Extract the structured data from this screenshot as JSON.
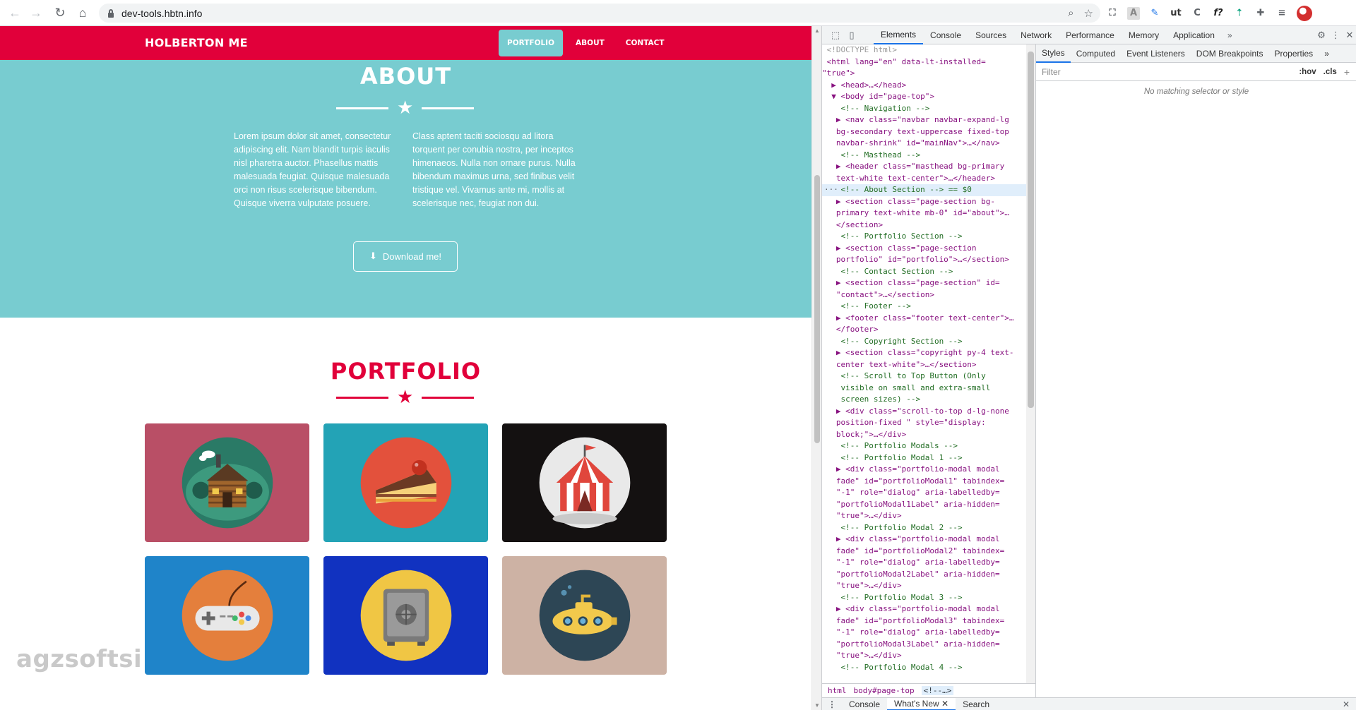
{
  "browser": {
    "url": "dev-tools.hbtn.info",
    "back_icon": "arrow-left-icon",
    "forward_icon": "arrow-right-icon",
    "reload_icon": "reload-icon",
    "home_icon": "home-icon",
    "extensions": [
      "zoom-icon",
      "bookmark-star-icon",
      "tab-search-icon",
      "extension-a-icon",
      "extension-feather-icon",
      "extension-ut-icon",
      "extension-c-icon",
      "extension-f-icon",
      "extension-arrow-icon",
      "puzzle-icon",
      "reading-list-icon",
      "profile-avatar"
    ]
  },
  "site": {
    "brand": "HOLBERTON ME",
    "nav": [
      {
        "label": "PORTFOLIO",
        "active": true
      },
      {
        "label": "ABOUT",
        "active": false
      },
      {
        "label": "CONTACT",
        "active": false
      }
    ],
    "about": {
      "title": "ABOUT",
      "left_text": "Lorem ipsum dolor sit amet, consectetur adipiscing elit. Nam blandit turpis iaculis nisl pharetra auctor. Phasellus mattis malesuada feugiat. Quisque malesuada orci non risus scelerisque bibendum. Quisque viverra vulputate posuere.",
      "right_text": "Class aptent taciti sociosqu ad litora torquent per conubia nostra, per inceptos himenaeos. Nulla non ornare purus. Nulla bibendum maximus urna, sed finibus velit tristique vel. Vivamus ante mi, mollis at scelerisque nec, feugiat non dui.",
      "button": "Download me!"
    },
    "portfolio": {
      "title": "PORTFOLIO",
      "tiles": [
        {
          "name": "cabin",
          "bg": "#b94f66",
          "circle": "#2a7a66"
        },
        {
          "name": "cake",
          "bg": "#23a3b6",
          "circle": "#e3513c"
        },
        {
          "name": "circus",
          "bg": "#141111",
          "circle": "#e9e9e9"
        },
        {
          "name": "game",
          "bg": "#1f84c9",
          "circle": "#e47f3c"
        },
        {
          "name": "safe",
          "bg": "#1132c0",
          "circle": "#f0c644"
        },
        {
          "name": "submarine",
          "bg": "#cdb2a4",
          "circle": "#2d4655"
        }
      ]
    },
    "colors": {
      "primary": "#e1003a",
      "secondary": "#78ccd0"
    }
  },
  "watermark": "agzsoftsi",
  "devtools": {
    "tabs": [
      "Elements",
      "Console",
      "Sources",
      "Network",
      "Performance",
      "Memory",
      "Application"
    ],
    "active_tab": "Elements",
    "more": "»",
    "tree": [
      {
        "t": "<!DOCTYPE html>",
        "k": "gray",
        "i": 1
      },
      {
        "t": "<html lang=\"en\" data-lt-installed=",
        "k": "tag",
        "i": 1
      },
      {
        "t": "\"true\">",
        "k": "tag",
        "i": 0
      },
      {
        "t": "▶ <head>…</head>",
        "k": "tag",
        "i": 2
      },
      {
        "t": "▼ <body id=\"page-top\">",
        "k": "tag",
        "i": 2
      },
      {
        "t": "<!-- Navigation -->",
        "k": "cmt",
        "i": 4
      },
      {
        "t": "▶ <nav class=\"navbar navbar-expand-lg",
        "k": "tag",
        "i": 3
      },
      {
        "t": "bg-secondary text-uppercase fixed-top",
        "k": "tag",
        "i": 3
      },
      {
        "t": "navbar-shrink\" id=\"mainNav\">…</nav>",
        "k": "tag",
        "i": 3
      },
      {
        "t": "<!-- Masthead -->",
        "k": "cmt",
        "i": 4
      },
      {
        "t": "▶ <header class=\"masthead bg-primary",
        "k": "tag",
        "i": 3
      },
      {
        "t": "text-white text-center\">…</header>",
        "k": "tag",
        "i": 3
      },
      {
        "t": "<!-- About Section --> == $0",
        "k": "cmt",
        "i": 4,
        "sel": true
      },
      {
        "t": "▶ <section class=\"page-section bg-",
        "k": "tag",
        "i": 3
      },
      {
        "t": "primary text-white mb-0\" id=\"about\">…",
        "k": "tag",
        "i": 3
      },
      {
        "t": "</section>",
        "k": "tag",
        "i": 3
      },
      {
        "t": "<!-- Portfolio Section -->",
        "k": "cmt",
        "i": 4
      },
      {
        "t": "▶ <section class=\"page-section",
        "k": "tag",
        "i": 3
      },
      {
        "t": "portfolio\" id=\"portfolio\">…</section>",
        "k": "tag",
        "i": 3
      },
      {
        "t": "<!-- Contact Section -->",
        "k": "cmt",
        "i": 4
      },
      {
        "t": "▶ <section class=\"page-section\" id=",
        "k": "tag",
        "i": 3
      },
      {
        "t": "\"contact\">…</section>",
        "k": "tag",
        "i": 3
      },
      {
        "t": "<!-- Footer -->",
        "k": "cmt",
        "i": 4
      },
      {
        "t": "▶ <footer class=\"footer text-center\">…",
        "k": "tag",
        "i": 3
      },
      {
        "t": "</footer>",
        "k": "tag",
        "i": 3
      },
      {
        "t": "<!-- Copyright Section -->",
        "k": "cmt",
        "i": 4
      },
      {
        "t": "▶ <section class=\"copyright py-4 text-",
        "k": "tag",
        "i": 3
      },
      {
        "t": "center text-white\">…</section>",
        "k": "tag",
        "i": 3
      },
      {
        "t": "<!-- Scroll to Top Button (Only",
        "k": "cmt",
        "i": 4
      },
      {
        "t": "visible on small and extra-small",
        "k": "cmt",
        "i": 4
      },
      {
        "t": "screen sizes) -->",
        "k": "cmt",
        "i": 4
      },
      {
        "t": "▶ <div class=\"scroll-to-top d-lg-none",
        "k": "tag",
        "i": 3
      },
      {
        "t": "position-fixed \" style=\"display:",
        "k": "tag",
        "i": 3
      },
      {
        "t": "block;\">…</div>",
        "k": "tag",
        "i": 3
      },
      {
        "t": "<!-- Portfolio Modals -->",
        "k": "cmt",
        "i": 4
      },
      {
        "t": "<!-- Portfolio Modal 1 -->",
        "k": "cmt",
        "i": 4
      },
      {
        "t": "▶ <div class=\"portfolio-modal modal",
        "k": "tag",
        "i": 3
      },
      {
        "t": "fade\" id=\"portfolioModal1\" tabindex=",
        "k": "tag",
        "i": 3
      },
      {
        "t": "\"-1\" role=\"dialog\" aria-labelledby=",
        "k": "tag",
        "i": 3
      },
      {
        "t": "\"portfolioModal1Label\" aria-hidden=",
        "k": "tag",
        "i": 3
      },
      {
        "t": "\"true\">…</div>",
        "k": "tag",
        "i": 3
      },
      {
        "t": "<!-- Portfolio Modal 2 -->",
        "k": "cmt",
        "i": 4
      },
      {
        "t": "▶ <div class=\"portfolio-modal modal",
        "k": "tag",
        "i": 3
      },
      {
        "t": "fade\" id=\"portfolioModal2\" tabindex=",
        "k": "tag",
        "i": 3
      },
      {
        "t": "\"-1\" role=\"dialog\" aria-labelledby=",
        "k": "tag",
        "i": 3
      },
      {
        "t": "\"portfolioModal2Label\" aria-hidden=",
        "k": "tag",
        "i": 3
      },
      {
        "t": "\"true\">…</div>",
        "k": "tag",
        "i": 3
      },
      {
        "t": "<!-- Portfolio Modal 3 -->",
        "k": "cmt",
        "i": 4
      },
      {
        "t": "▶ <div class=\"portfolio-modal modal",
        "k": "tag",
        "i": 3
      },
      {
        "t": "fade\" id=\"portfolioModal3\" tabindex=",
        "k": "tag",
        "i": 3
      },
      {
        "t": "\"-1\" role=\"dialog\" aria-labelledby=",
        "k": "tag",
        "i": 3
      },
      {
        "t": "\"portfolioModal3Label\" aria-hidden=",
        "k": "tag",
        "i": 3
      },
      {
        "t": "\"true\">…</div>",
        "k": "tag",
        "i": 3
      },
      {
        "t": "<!-- Portfolio Modal 4 -->",
        "k": "cmt",
        "i": 4
      }
    ],
    "breadcrumb": [
      "html",
      "body#page-top",
      "<!--…>"
    ],
    "styles_tabs": [
      "Styles",
      "Computed",
      "Event Listeners",
      "DOM Breakpoints",
      "Properties"
    ],
    "styles_more": "»",
    "filter_placeholder": "Filter",
    "hov": ":hov",
    "cls": ".cls",
    "add": "+",
    "empty_message": "No matching selector or style",
    "drawer_tabs": [
      "Console",
      "What's New",
      "Search"
    ],
    "drawer_active": "What's New"
  }
}
